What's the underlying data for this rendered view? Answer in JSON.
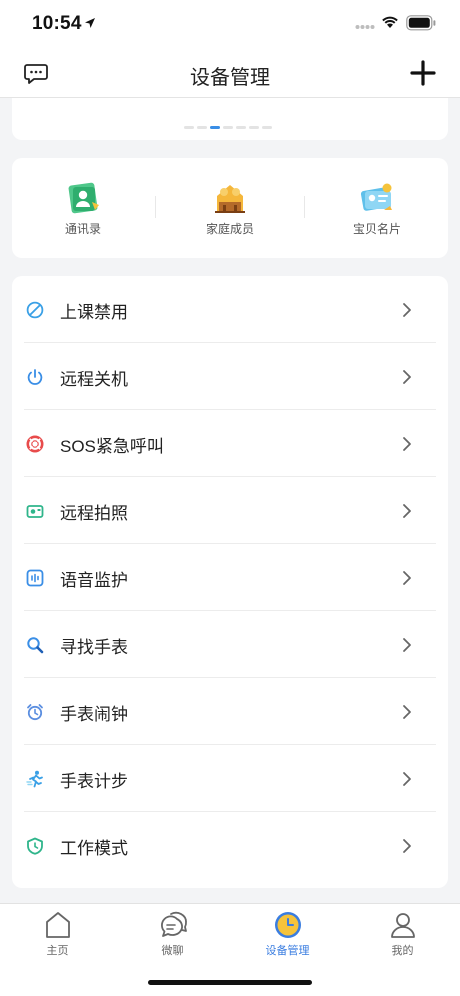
{
  "status_bar": {
    "time": "10:54"
  },
  "nav": {
    "title": "设备管理"
  },
  "banner": {
    "page_count": 7,
    "active_index": 2
  },
  "quick_access": [
    {
      "label": "通讯录",
      "icon": "contacts-icon"
    },
    {
      "label": "家庭成员",
      "icon": "family-members-icon"
    },
    {
      "label": "宝贝名片",
      "icon": "baby-card-icon"
    }
  ],
  "menu": [
    {
      "label": "上课禁用",
      "icon": "class-disable-icon",
      "color": "#3aa0e6"
    },
    {
      "label": "远程关机",
      "icon": "power-icon",
      "color": "#3a8ee6"
    },
    {
      "label": "SOS紧急呼叫",
      "icon": "sos-lifebuoy-icon",
      "color": "#e84b4b"
    },
    {
      "label": "远程拍照",
      "icon": "camera-icon",
      "color": "#2fb58b"
    },
    {
      "label": "语音监护",
      "icon": "voice-monitor-icon",
      "color": "#3a8ee6"
    },
    {
      "label": "寻找手表",
      "icon": "search-watch-icon",
      "color": "#3a8ee6"
    },
    {
      "label": "手表闹钟",
      "icon": "alarm-clock-icon",
      "color": "#5c8fe0"
    },
    {
      "label": "手表计步",
      "icon": "step-counter-icon",
      "color": "#3aa0e6"
    },
    {
      "label": "工作模式",
      "icon": "work-mode-icon",
      "color": "#2fb58b"
    }
  ],
  "tabs": [
    {
      "label": "主页",
      "icon": "home-icon",
      "active": false
    },
    {
      "label": "微聊",
      "icon": "chat-icon",
      "active": false
    },
    {
      "label": "设备管理",
      "icon": "device-clock-icon",
      "active": true
    },
    {
      "label": "我的",
      "icon": "profile-icon",
      "active": false
    }
  ],
  "colors": {
    "accent": "#3a7de0",
    "background": "#f3f4f6",
    "card": "#ffffff"
  }
}
